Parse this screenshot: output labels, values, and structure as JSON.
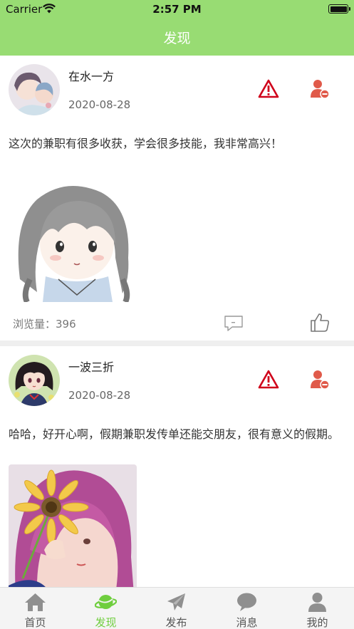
{
  "statusbar": {
    "carrier": "Carrier",
    "time": "2:57 PM",
    "wifi_icon": "wifi-icon",
    "battery_icon": "battery-icon"
  },
  "nav": {
    "title": "发现"
  },
  "colors": {
    "brand": "#98dc73",
    "tab_active": "#6fce3e",
    "warning_red": "#d0021b",
    "block_red": "#e05a4a"
  },
  "posts": [
    {
      "username": "在水一方",
      "date": "2020-08-28",
      "content": "这次的兼职有很多收获，学会很多技能，我非常高兴！",
      "views_label": "浏览量：",
      "views": "396",
      "icons": {
        "report": "warning-triangle-icon",
        "block": "block-user-icon",
        "comment": "comment-icon",
        "like": "thumbs-up-icon"
      }
    },
    {
      "username": "一波三折",
      "date": "2020-08-28",
      "content": "哈哈，好开心啊，假期兼职发传单还能交朋友，很有意义的假期。",
      "icons": {
        "report": "warning-triangle-icon",
        "block": "block-user-icon"
      }
    }
  ],
  "tabbar": {
    "active_index": 1,
    "tabs": [
      {
        "label": "首页",
        "icon": "home-icon"
      },
      {
        "label": "发现",
        "icon": "planet-icon"
      },
      {
        "label": "发布",
        "icon": "paper-plane-icon"
      },
      {
        "label": "消息",
        "icon": "message-bubble-icon"
      },
      {
        "label": "我的",
        "icon": "person-icon"
      }
    ]
  }
}
